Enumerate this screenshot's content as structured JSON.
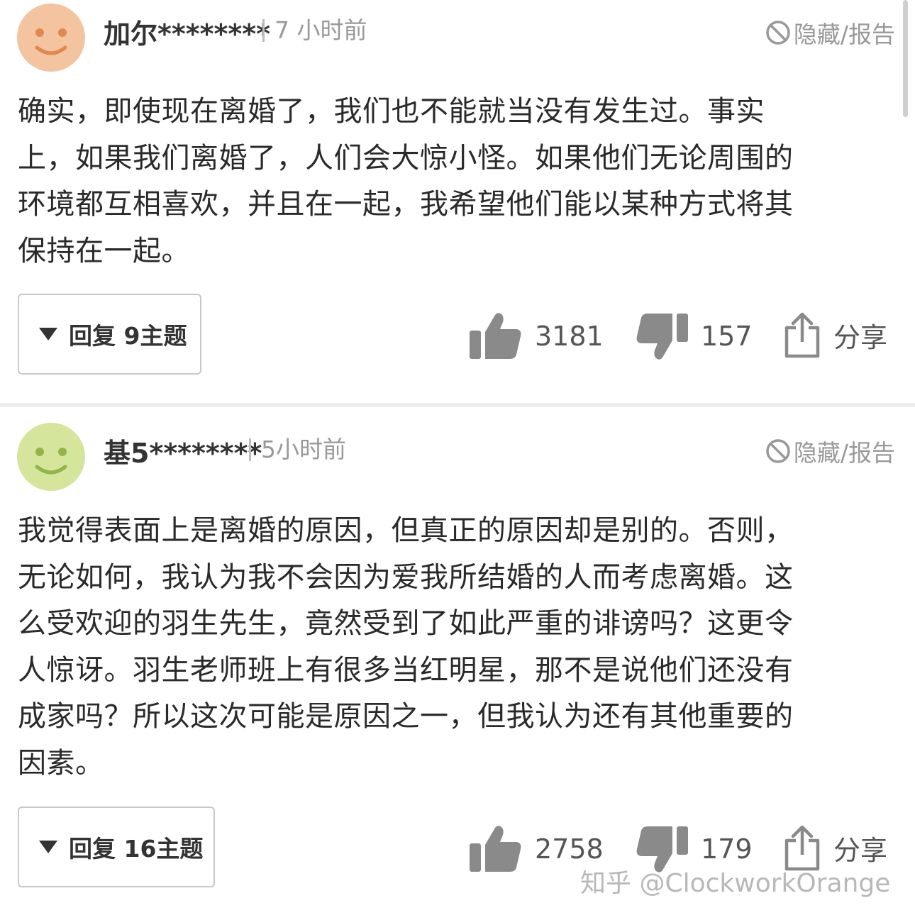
{
  "comments": [
    {
      "avatar_color": "#f4c39f",
      "username": "加尔********",
      "time": "7 小时前",
      "hide_report": "隐藏/报告",
      "lines": [
        "确实，即使现在离婚了，我们也不能就当没有发生过。事实",
        "上，如果我们离婚了，人们会大惊小怪。如果他们无论周围的",
        "环境都互相喜欢，并且在一起，我希望他们能以某种方式将其",
        "保持在一起。"
      ],
      "reply_label": "回复 9主题",
      "likes": "3181",
      "dislikes": "157",
      "share": "分享"
    },
    {
      "avatar_color": "#d5e59b",
      "username": "基5********",
      "time": "5小时前",
      "hide_report": "隐藏/报告",
      "lines": [
        "我觉得表面上是离婚的原因，但真正的原因却是别的。否则，",
        "无论如何，我认为我不会因为爱我所结婚的人而考虑离婚。这",
        "么受欢迎的羽生先生，竟然受到了如此严重的诽谤吗？这更令",
        "人惊讶。羽生老师班上有很多当红明星，那不是说他们还没有",
        "成家吗？所以这次可能是原因之一，但我认为还有其他重要的",
        "因素。"
      ],
      "reply_label": "回复 16主题",
      "likes": "2758",
      "dislikes": "179",
      "share": "分享"
    }
  ],
  "watermark": "知乎 @ClockworkOrange",
  "colors": {
    "icon_gray": "#8a8a8a",
    "text_dark": "#2a2a2a",
    "meta_gray": "#999999"
  }
}
